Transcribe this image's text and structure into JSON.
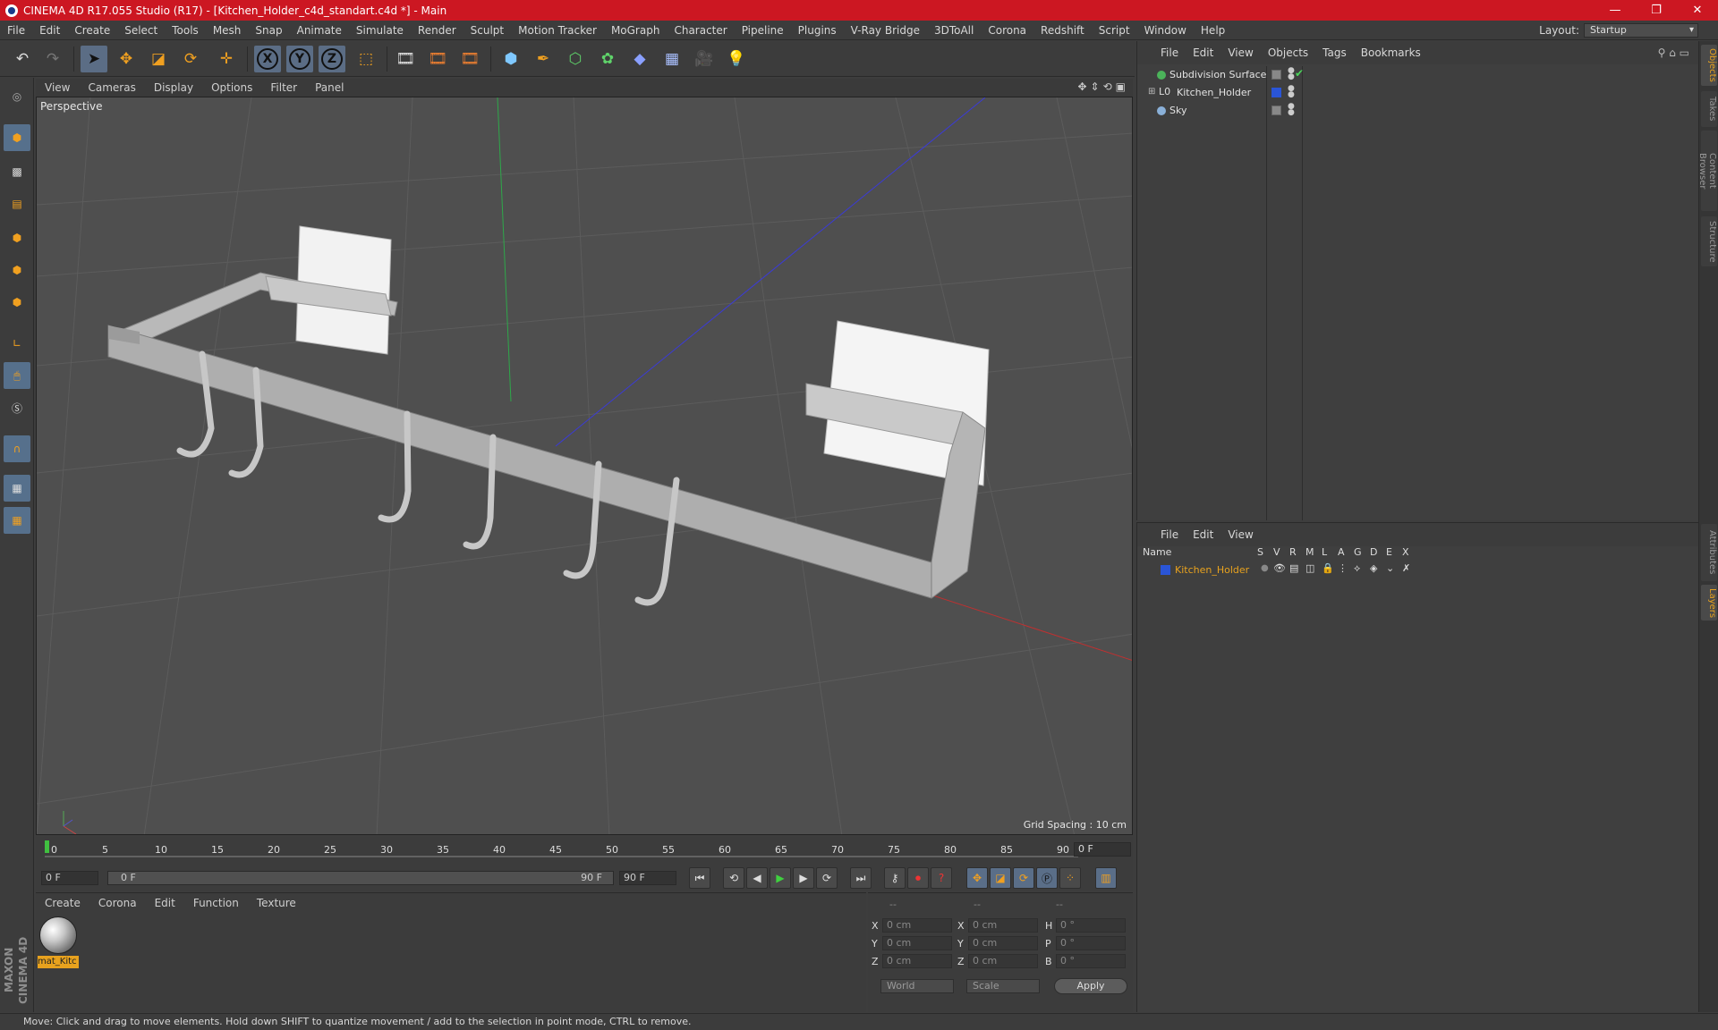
{
  "window": {
    "title": "CINEMA 4D R17.055 Studio (R17) - [Kitchen_Holder_c4d_standart.c4d *] - Main",
    "controls": [
      "—",
      "❐",
      "✕"
    ]
  },
  "menubar": [
    "File",
    "Edit",
    "Create",
    "Select",
    "Tools",
    "Mesh",
    "Snap",
    "Animate",
    "Simulate",
    "Render",
    "Sculpt",
    "Motion Tracker",
    "MoGraph",
    "Character",
    "Pipeline",
    "Plugins",
    "V-Ray Bridge",
    "3DToAll",
    "Corona",
    "Redshift",
    "Script",
    "Window",
    "Help"
  ],
  "layout": {
    "label": "Layout:",
    "value": "Startup"
  },
  "toolbar": {
    "axis_x": "X",
    "axis_y": "Y",
    "axis_z": "Z",
    "icons": [
      "undo-icon",
      "redo-icon",
      "select-icon",
      "move-icon",
      "scale-icon",
      "rotate-icon",
      "live-select-icon",
      "x-axis-icon",
      "y-axis-icon",
      "z-axis-icon",
      "coord-system-icon",
      "render-view-icon",
      "render-region-icon",
      "render-settings-icon",
      "cube-icon",
      "pen-icon",
      "subdivision-icon",
      "array-icon",
      "deformer-icon",
      "floor-icon",
      "camera-icon",
      "light-icon"
    ]
  },
  "viewport": {
    "menu": [
      "View",
      "Cameras",
      "Display",
      "Options",
      "Filter",
      "Panel"
    ],
    "label": "Perspective",
    "grid_spacing": "Grid Spacing : 10 cm"
  },
  "timeline": {
    "ticks": [
      "0",
      "5",
      "10",
      "15",
      "20",
      "25",
      "30",
      "35",
      "40",
      "45",
      "50",
      "55",
      "60",
      "65",
      "70",
      "75",
      "80",
      "85",
      "90"
    ],
    "current_frame": "0 F"
  },
  "transport": {
    "start": "0 F",
    "range_start": "0 F",
    "range_end": "90 F",
    "end": "90 F"
  },
  "material": {
    "menu": [
      "Create",
      "Corona",
      "Edit",
      "Function",
      "Texture"
    ],
    "name": "mat_Kitc"
  },
  "coords": {
    "header": [
      "--",
      "--",
      "--"
    ],
    "rows": [
      {
        "a": "X",
        "av": "0 cm",
        "b": "X",
        "bv": "0 cm",
        "c": "H",
        "cv": "0 °"
      },
      {
        "a": "Y",
        "av": "0 cm",
        "b": "Y",
        "bv": "0 cm",
        "c": "P",
        "cv": "0 °"
      },
      {
        "a": "Z",
        "av": "0 cm",
        "b": "Z",
        "bv": "0 cm",
        "c": "B",
        "cv": "0 °"
      }
    ],
    "world": "World",
    "scale": "Scale",
    "apply": "Apply"
  },
  "objects": {
    "menu": [
      "File",
      "Edit",
      "View",
      "Objects",
      "Tags",
      "Bookmarks"
    ],
    "items": [
      {
        "name": "Subdivision Surface"
      },
      {
        "name": "Kitchen_Holder"
      },
      {
        "name": "Sky"
      }
    ]
  },
  "layers": {
    "menu": [
      "File",
      "Edit",
      "View"
    ],
    "columns": [
      "Name",
      "S",
      "V",
      "R",
      "M",
      "L",
      "A",
      "G",
      "D",
      "E",
      "X"
    ],
    "items": [
      {
        "name": "Kitchen_Holder"
      }
    ]
  },
  "right_tabs": [
    "Objects",
    "Takes",
    "Content Browser",
    "Structure",
    "Attributes",
    "Layers"
  ],
  "status": "Move: Click and drag to move elements. Hold down SHIFT to quantize movement / add to the selection in point mode, CTRL to remove.",
  "brand": "MAXON CINEMA 4D",
  "colors": {
    "accent": "#e8a21e",
    "title_bar": "#cc1722",
    "layer_blue": "#2a55d6"
  }
}
